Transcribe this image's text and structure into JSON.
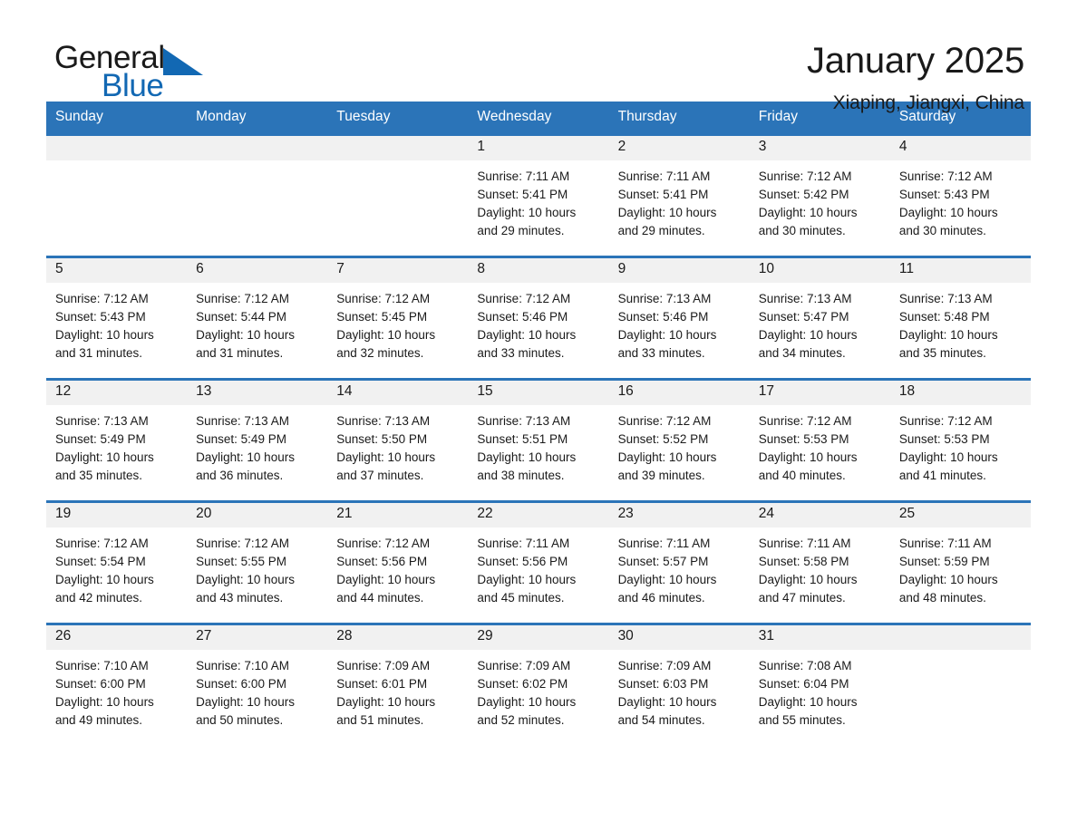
{
  "brand": {
    "name_part1": "General",
    "name_part2": "Blue",
    "triangle_color": "#1268b3",
    "blue_color": "#1268b3"
  },
  "header": {
    "title": "January 2025",
    "subtitle": "Xiaping, Jiangxi, China"
  },
  "theme": {
    "header_blue": "#2b74b8",
    "daynum_band": "#f1f1f1",
    "text": "#1a1a1a"
  },
  "calendar": {
    "weekday_headers": [
      "Sunday",
      "Monday",
      "Tuesday",
      "Wednesday",
      "Thursday",
      "Friday",
      "Saturday"
    ],
    "weeks": [
      [
        {
          "day": "",
          "sunrise": "",
          "sunset": "",
          "daylight_line1": "",
          "daylight_line2": ""
        },
        {
          "day": "",
          "sunrise": "",
          "sunset": "",
          "daylight_line1": "",
          "daylight_line2": ""
        },
        {
          "day": "",
          "sunrise": "",
          "sunset": "",
          "daylight_line1": "",
          "daylight_line2": ""
        },
        {
          "day": "1",
          "sunrise": "Sunrise: 7:11 AM",
          "sunset": "Sunset: 5:41 PM",
          "daylight_line1": "Daylight: 10 hours",
          "daylight_line2": "and 29 minutes."
        },
        {
          "day": "2",
          "sunrise": "Sunrise: 7:11 AM",
          "sunset": "Sunset: 5:41 PM",
          "daylight_line1": "Daylight: 10 hours",
          "daylight_line2": "and 29 minutes."
        },
        {
          "day": "3",
          "sunrise": "Sunrise: 7:12 AM",
          "sunset": "Sunset: 5:42 PM",
          "daylight_line1": "Daylight: 10 hours",
          "daylight_line2": "and 30 minutes."
        },
        {
          "day": "4",
          "sunrise": "Sunrise: 7:12 AM",
          "sunset": "Sunset: 5:43 PM",
          "daylight_line1": "Daylight: 10 hours",
          "daylight_line2": "and 30 minutes."
        }
      ],
      [
        {
          "day": "5",
          "sunrise": "Sunrise: 7:12 AM",
          "sunset": "Sunset: 5:43 PM",
          "daylight_line1": "Daylight: 10 hours",
          "daylight_line2": "and 31 minutes."
        },
        {
          "day": "6",
          "sunrise": "Sunrise: 7:12 AM",
          "sunset": "Sunset: 5:44 PM",
          "daylight_line1": "Daylight: 10 hours",
          "daylight_line2": "and 31 minutes."
        },
        {
          "day": "7",
          "sunrise": "Sunrise: 7:12 AM",
          "sunset": "Sunset: 5:45 PM",
          "daylight_line1": "Daylight: 10 hours",
          "daylight_line2": "and 32 minutes."
        },
        {
          "day": "8",
          "sunrise": "Sunrise: 7:12 AM",
          "sunset": "Sunset: 5:46 PM",
          "daylight_line1": "Daylight: 10 hours",
          "daylight_line2": "and 33 minutes."
        },
        {
          "day": "9",
          "sunrise": "Sunrise: 7:13 AM",
          "sunset": "Sunset: 5:46 PM",
          "daylight_line1": "Daylight: 10 hours",
          "daylight_line2": "and 33 minutes."
        },
        {
          "day": "10",
          "sunrise": "Sunrise: 7:13 AM",
          "sunset": "Sunset: 5:47 PM",
          "daylight_line1": "Daylight: 10 hours",
          "daylight_line2": "and 34 minutes."
        },
        {
          "day": "11",
          "sunrise": "Sunrise: 7:13 AM",
          "sunset": "Sunset: 5:48 PM",
          "daylight_line1": "Daylight: 10 hours",
          "daylight_line2": "and 35 minutes."
        }
      ],
      [
        {
          "day": "12",
          "sunrise": "Sunrise: 7:13 AM",
          "sunset": "Sunset: 5:49 PM",
          "daylight_line1": "Daylight: 10 hours",
          "daylight_line2": "and 35 minutes."
        },
        {
          "day": "13",
          "sunrise": "Sunrise: 7:13 AM",
          "sunset": "Sunset: 5:49 PM",
          "daylight_line1": "Daylight: 10 hours",
          "daylight_line2": "and 36 minutes."
        },
        {
          "day": "14",
          "sunrise": "Sunrise: 7:13 AM",
          "sunset": "Sunset: 5:50 PM",
          "daylight_line1": "Daylight: 10 hours",
          "daylight_line2": "and 37 minutes."
        },
        {
          "day": "15",
          "sunrise": "Sunrise: 7:13 AM",
          "sunset": "Sunset: 5:51 PM",
          "daylight_line1": "Daylight: 10 hours",
          "daylight_line2": "and 38 minutes."
        },
        {
          "day": "16",
          "sunrise": "Sunrise: 7:12 AM",
          "sunset": "Sunset: 5:52 PM",
          "daylight_line1": "Daylight: 10 hours",
          "daylight_line2": "and 39 minutes."
        },
        {
          "day": "17",
          "sunrise": "Sunrise: 7:12 AM",
          "sunset": "Sunset: 5:53 PM",
          "daylight_line1": "Daylight: 10 hours",
          "daylight_line2": "and 40 minutes."
        },
        {
          "day": "18",
          "sunrise": "Sunrise: 7:12 AM",
          "sunset": "Sunset: 5:53 PM",
          "daylight_line1": "Daylight: 10 hours",
          "daylight_line2": "and 41 minutes."
        }
      ],
      [
        {
          "day": "19",
          "sunrise": "Sunrise: 7:12 AM",
          "sunset": "Sunset: 5:54 PM",
          "daylight_line1": "Daylight: 10 hours",
          "daylight_line2": "and 42 minutes."
        },
        {
          "day": "20",
          "sunrise": "Sunrise: 7:12 AM",
          "sunset": "Sunset: 5:55 PM",
          "daylight_line1": "Daylight: 10 hours",
          "daylight_line2": "and 43 minutes."
        },
        {
          "day": "21",
          "sunrise": "Sunrise: 7:12 AM",
          "sunset": "Sunset: 5:56 PM",
          "daylight_line1": "Daylight: 10 hours",
          "daylight_line2": "and 44 minutes."
        },
        {
          "day": "22",
          "sunrise": "Sunrise: 7:11 AM",
          "sunset": "Sunset: 5:56 PM",
          "daylight_line1": "Daylight: 10 hours",
          "daylight_line2": "and 45 minutes."
        },
        {
          "day": "23",
          "sunrise": "Sunrise: 7:11 AM",
          "sunset": "Sunset: 5:57 PM",
          "daylight_line1": "Daylight: 10 hours",
          "daylight_line2": "and 46 minutes."
        },
        {
          "day": "24",
          "sunrise": "Sunrise: 7:11 AM",
          "sunset": "Sunset: 5:58 PM",
          "daylight_line1": "Daylight: 10 hours",
          "daylight_line2": "and 47 minutes."
        },
        {
          "day": "25",
          "sunrise": "Sunrise: 7:11 AM",
          "sunset": "Sunset: 5:59 PM",
          "daylight_line1": "Daylight: 10 hours",
          "daylight_line2": "and 48 minutes."
        }
      ],
      [
        {
          "day": "26",
          "sunrise": "Sunrise: 7:10 AM",
          "sunset": "Sunset: 6:00 PM",
          "daylight_line1": "Daylight: 10 hours",
          "daylight_line2": "and 49 minutes."
        },
        {
          "day": "27",
          "sunrise": "Sunrise: 7:10 AM",
          "sunset": "Sunset: 6:00 PM",
          "daylight_line1": "Daylight: 10 hours",
          "daylight_line2": "and 50 minutes."
        },
        {
          "day": "28",
          "sunrise": "Sunrise: 7:09 AM",
          "sunset": "Sunset: 6:01 PM",
          "daylight_line1": "Daylight: 10 hours",
          "daylight_line2": "and 51 minutes."
        },
        {
          "day": "29",
          "sunrise": "Sunrise: 7:09 AM",
          "sunset": "Sunset: 6:02 PM",
          "daylight_line1": "Daylight: 10 hours",
          "daylight_line2": "and 52 minutes."
        },
        {
          "day": "30",
          "sunrise": "Sunrise: 7:09 AM",
          "sunset": "Sunset: 6:03 PM",
          "daylight_line1": "Daylight: 10 hours",
          "daylight_line2": "and 54 minutes."
        },
        {
          "day": "31",
          "sunrise": "Sunrise: 7:08 AM",
          "sunset": "Sunset: 6:04 PM",
          "daylight_line1": "Daylight: 10 hours",
          "daylight_line2": "and 55 minutes."
        },
        {
          "day": "",
          "sunrise": "",
          "sunset": "",
          "daylight_line1": "",
          "daylight_line2": ""
        }
      ]
    ]
  }
}
